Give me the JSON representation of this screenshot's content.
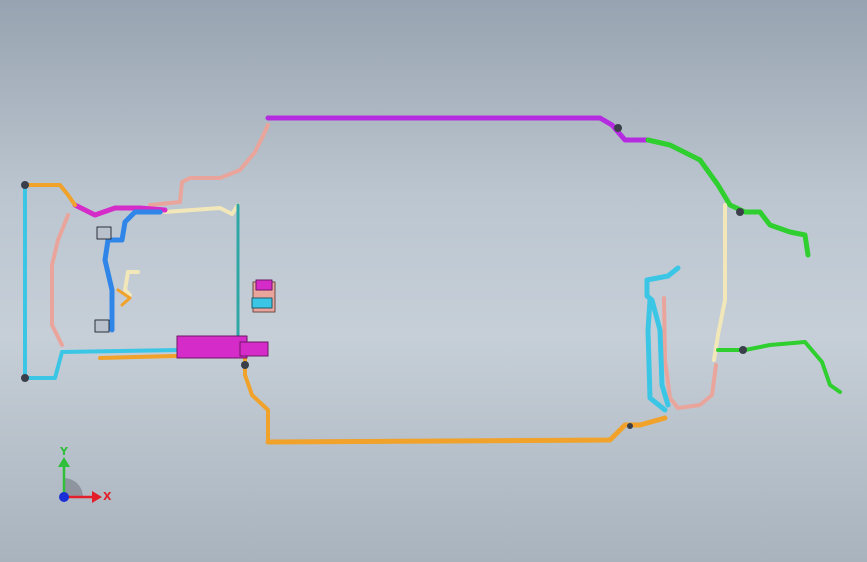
{
  "view": {
    "colors": {
      "purple": "#b52be0",
      "magenta": "#d42bc9",
      "green": "#2fcf2f",
      "cream": "#f1e7b8",
      "salmon": "#e9a59b",
      "orange": "#f0a22a",
      "cyan": "#3bc6e6",
      "blue": "#2f86e8",
      "teal": "#2fa7a7",
      "dark": "#3a3f4a"
    }
  },
  "triad": {
    "y_label": "Y",
    "x_label": "X",
    "y_color": "#2fbf3a",
    "x_color": "#e3202a",
    "z_color": "#1a2fd6"
  }
}
